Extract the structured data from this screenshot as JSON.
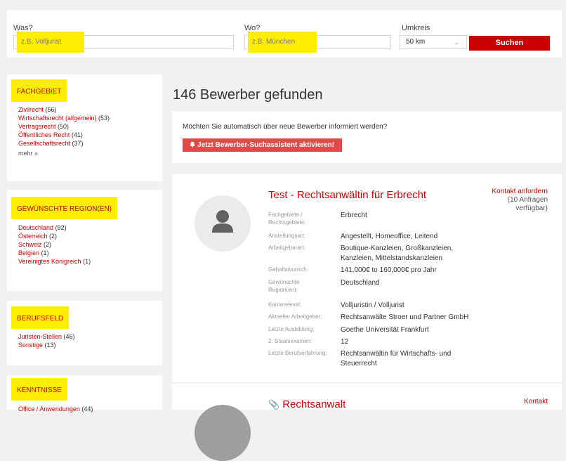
{
  "search": {
    "was_label": "Was?",
    "was_placeholder": "z.B. Volljurist",
    "wo_label": "Wo?",
    "wo_placeholder": "z.B. München",
    "umkreis_label": "Umkreis",
    "umkreis_value": "50 km",
    "search_button": "Suchen"
  },
  "facets": [
    {
      "title": "FACHGEBIET",
      "items": [
        {
          "label": "Zivilrecht",
          "count": "(56)"
        },
        {
          "label": "Wirtschaftsrecht (allgemein)",
          "count": "(53)"
        },
        {
          "label": "Vertragsrecht",
          "count": "(50)"
        },
        {
          "label": "Öffentliches Recht",
          "count": "(41)"
        },
        {
          "label": "Gesellschaftsrecht",
          "count": "(37)"
        }
      ],
      "more": "mehr »"
    },
    {
      "title": "GEWÜNSCHTE REGION(EN)",
      "items": [
        {
          "label": "Deutschland",
          "count": "(92)"
        },
        {
          "label": "Österreich",
          "count": "(2)"
        },
        {
          "label": "Schweiz",
          "count": "(2)"
        },
        {
          "label": "Belgien",
          "count": "(1)"
        },
        {
          "label": "Vereinigtes Königreich",
          "count": "(1)"
        }
      ]
    },
    {
      "title": "BERUFSFELD",
      "items": [
        {
          "label": "Juristen-Stellen",
          "count": "(46)"
        },
        {
          "label": "Sonstige",
          "count": "(13)"
        }
      ]
    },
    {
      "title": "KENNTNISSE",
      "items": [
        {
          "label": "Office / Anwendungen",
          "count": "(44)"
        }
      ]
    }
  ],
  "results": {
    "count_title": "146 Bewerber gefunden",
    "alert_text": "Möchten Sie automatisch über neue Bewerber informiert werden?",
    "alert_button": "Jetzt Bewerber-Suchassistent aktivieren!",
    "alert_icon": "bell-icon"
  },
  "cards": [
    {
      "title": "Test - Rechtsanwältin für Erbrecht",
      "kontakt": "Kontakt anfordern",
      "kontakt_sub": "(10 Anfragen verfügbar)",
      "avatar_icon": "user-icon",
      "details": [
        {
          "label": "Fachgebiete / Rechtsgebiete:",
          "value": "Erbrecht"
        },
        {
          "label": "Anstellungsart:",
          "value": "Angestellt, Homeoffice, Leitend"
        },
        {
          "label": "Arbeitgeberart:",
          "value": "Boutique-Kanzleien, Großkanzleien, Kanzleien, Mittelstandskanzleien"
        },
        {
          "label": "Gehaltswunsch:",
          "value": "141,000€ to 160,000€ pro Jahr"
        },
        {
          "label": "Gewünschte Region(en):",
          "value": "Deutschland"
        },
        {
          "label": "Karrierelevel:",
          "value": "Volljuristin / Volljurist"
        },
        {
          "label": "Aktueller Arbeitgeber:",
          "value": "Rechtsanwälte Stroer und Partner GmbH"
        },
        {
          "label": "Letzte Ausbildung:",
          "value": "Goethe Universität Frankfurt"
        },
        {
          "label": "2. Staatsexamen:",
          "value": "12"
        },
        {
          "label": "Letzte Berufserfahrung:",
          "value": "Rechtsanwältin für Wirtschafts- und Steuerrecht"
        }
      ]
    },
    {
      "title": "Rechtsanwalt",
      "title_icon": "paperclip-icon",
      "kontakt": "Kontakt"
    }
  ]
}
